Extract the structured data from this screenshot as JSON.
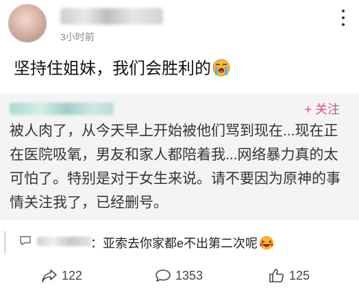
{
  "header": {
    "time": "3小时前"
  },
  "post": {
    "text": "坚持住姐妹，我们会胜利的"
  },
  "quote": {
    "follow_label": "+ 关注",
    "text": "被人肉了，从今天早上开始被他们骂到现在...现在正在医院吸氧，男友和家人都陪着我...网络暴力真的太可怕了。特别是对于女生来说。请不要因为原神的事情关注我了，已经删号。"
  },
  "comment": {
    "text": "：亚索去你家都e不出第二次呢"
  },
  "actions": {
    "repost_count": "122",
    "comment_count": "1353",
    "like_count": "125"
  },
  "colors": {
    "follow": "#e2506e",
    "card_bg": "#f4f4f4"
  },
  "icons": {
    "post_emoji": "crying-emoji-icon",
    "comment_emoji": "laughing-emoji-icon",
    "repost": "share-arrow-icon",
    "comment": "speech-bubble-icon",
    "like": "thumbs-up-icon",
    "more": "more-options-icon"
  }
}
